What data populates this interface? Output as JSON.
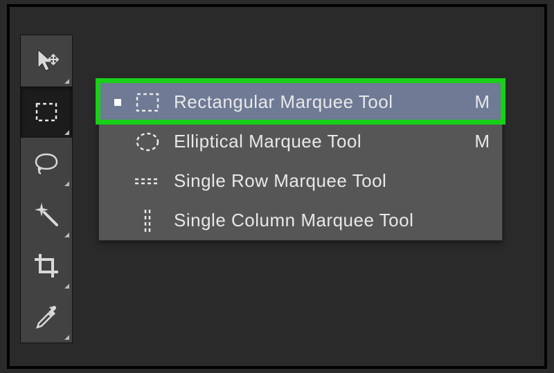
{
  "toolbar": {
    "tools": [
      {
        "name": "move-tool"
      },
      {
        "name": "rectangular-marquee-tool",
        "active": true
      },
      {
        "name": "lasso-tool"
      },
      {
        "name": "magic-wand-tool"
      },
      {
        "name": "crop-tool"
      },
      {
        "name": "eyedropper-tool"
      }
    ]
  },
  "flyout": {
    "items": [
      {
        "key": "rect",
        "label": "Rectangular Marquee Tool",
        "shortcut": "M",
        "selected": true
      },
      {
        "key": "ellipse",
        "label": "Elliptical Marquee Tool",
        "shortcut": "M",
        "selected": false
      },
      {
        "key": "row",
        "label": "Single Row Marquee Tool",
        "shortcut": "",
        "selected": false
      },
      {
        "key": "col",
        "label": "Single Column Marquee Tool",
        "shortcut": "",
        "selected": false
      }
    ]
  },
  "highlight_color": "#18d018"
}
